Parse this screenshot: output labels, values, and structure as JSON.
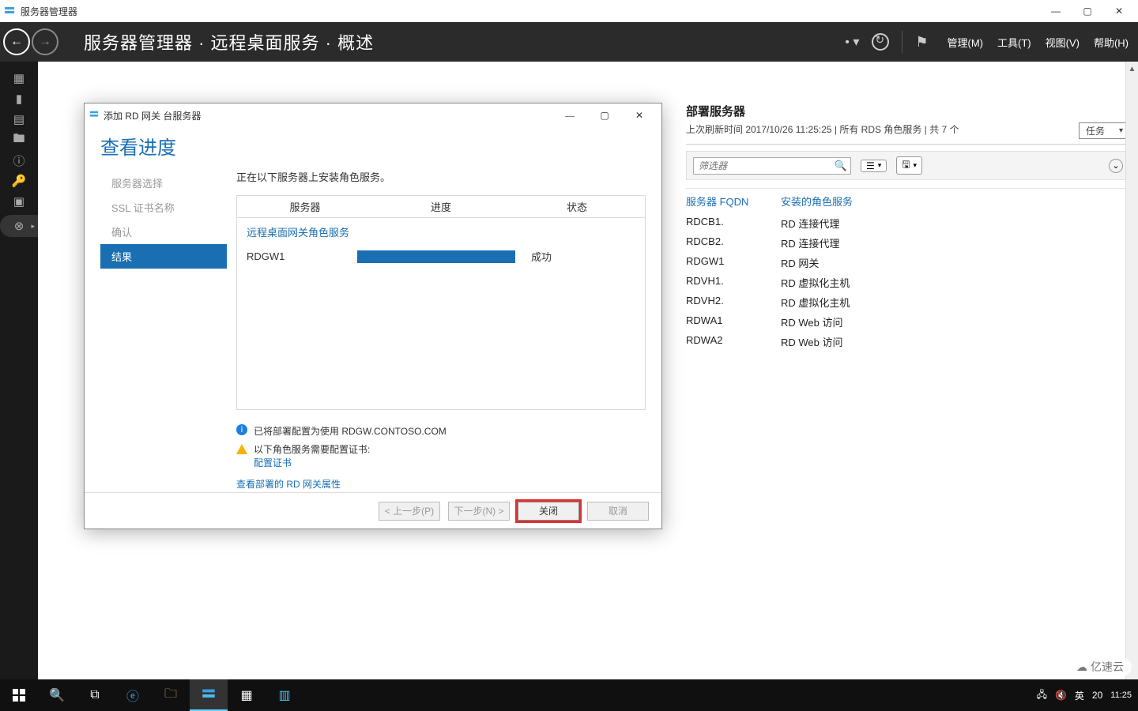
{
  "window": {
    "title": "服务器管理器",
    "minimize": "—",
    "maximize": "▢",
    "close": "✕"
  },
  "header": {
    "title_main": "服务器管理器 · 远程桌面服务 · 概述",
    "menu_manage": "管理(M)",
    "menu_tools": "工具(T)",
    "menu_view": "视图(V)",
    "menu_help": "帮助(H)"
  },
  "right": {
    "title": "部署服务器",
    "subtitle": "上次刷新时间 2017/10/26 11:25:25 | 所有 RDS 角色服务 | 共 7 个",
    "tasks": "任务",
    "filter_placeholder": "筛选器",
    "col_fqdn": "服务器 FQDN",
    "col_role": "安装的角色服务",
    "rows": [
      {
        "fqdn": "RDCB1.",
        "role": "RD 连接代理"
      },
      {
        "fqdn": "RDCB2.",
        "role": "RD 连接代理"
      },
      {
        "fqdn": "RDGW1",
        "role": "RD 网关"
      },
      {
        "fqdn": "RDVH1.",
        "role": "RD 虚拟化主机"
      },
      {
        "fqdn": "RDVH2.",
        "role": "RD 虚拟化主机"
      },
      {
        "fqdn": "RDWA1",
        "role": "RD Web 访问"
      },
      {
        "fqdn": "RDWA2",
        "role": "RD Web 访问"
      }
    ]
  },
  "wizard": {
    "title_bar": "添加 RD 网关 台服务器",
    "heading": "查看进度",
    "nav": {
      "server_select": "服务器选择",
      "ssl_name": "SSL 证书名称",
      "confirm": "确认",
      "result": "结果"
    },
    "installing": "正在以下服务器上安装角色服务。",
    "th_server": "服务器",
    "th_progress": "进度",
    "th_status": "状态",
    "section": "远程桌面网关角色服务",
    "row_server": "RDGW1",
    "row_status": "成功",
    "info_text": "已将部署配置为使用 RDGW.CONTOSO.COM",
    "warn_text": "以下角色服务需要配置证书:",
    "warn_link": "配置证书",
    "view_props_link": "查看部署的 RD 网关属性",
    "btn_prev": "< 上一步(P)",
    "btn_next": "下一步(N) >",
    "btn_close": "关闭",
    "btn_cancel": "取消"
  },
  "taskbar": {
    "ime_lang": "英",
    "time": "11:25",
    "date_token": "20",
    "watermark": "亿速云"
  }
}
